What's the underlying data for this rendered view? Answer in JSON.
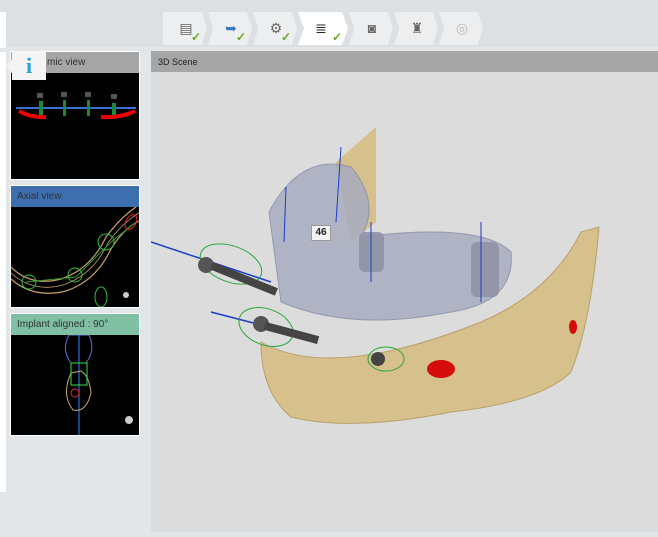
{
  "workflow_steps": [
    {
      "name": "patient-data",
      "done": true
    },
    {
      "name": "import",
      "done": true
    },
    {
      "name": "segmentation",
      "done": true
    },
    {
      "name": "implant-planning",
      "done": true,
      "active": true
    },
    {
      "name": "sleeve",
      "done": false
    },
    {
      "name": "report",
      "done": false
    },
    {
      "name": "export-disc",
      "done": false
    }
  ],
  "sidebar": {
    "info_icon": "i",
    "panoramic": {
      "title": "Panoramic view",
      "visible_title": "mic view"
    },
    "axial": {
      "title": "Axial view"
    },
    "implant": {
      "title": "Implant aligned : 90°"
    }
  },
  "scene": {
    "title": "3D Scene",
    "tooth_label": "46"
  },
  "colors": {
    "axial_header": "#3d6fae",
    "implant_header": "#7fbfa4",
    "panel_header": "#a5a5a5",
    "bone": "#d6c08c"
  }
}
